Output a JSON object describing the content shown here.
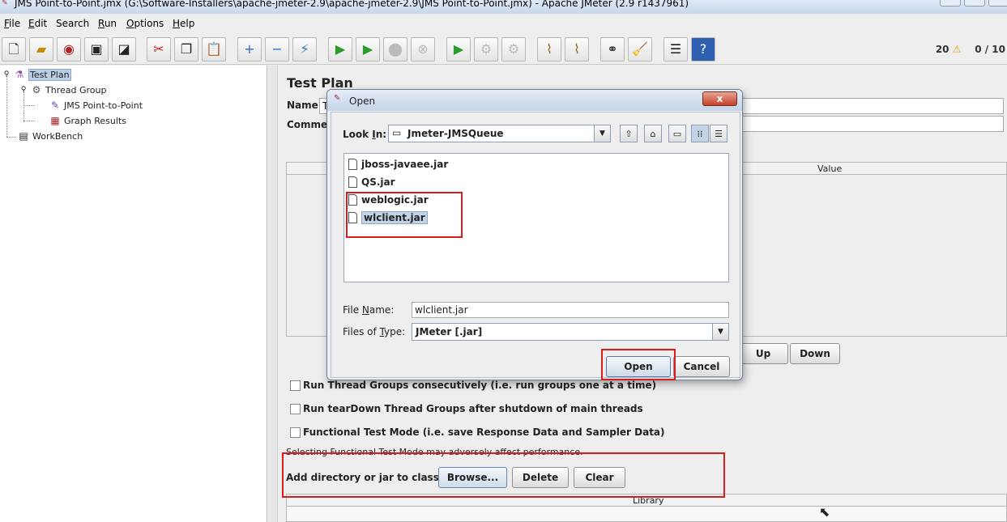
{
  "window": {
    "title": "JMS Point-to-Point.jmx (G:\\Software-Installers\\apache-jmeter-2.9\\apache-jmeter-2.9\\JMS Point-to-Point.jmx) - Apache JMeter (2.9 r1437961)"
  },
  "menu": [
    {
      "label": "File",
      "mnemonic": "F",
      "rest": "ile"
    },
    {
      "label": "Edit",
      "mnemonic": "E",
      "rest": "dit"
    },
    {
      "label": "Search",
      "mnemonic": "",
      "rest": "Search"
    },
    {
      "label": "Run",
      "mnemonic": "R",
      "rest": "un"
    },
    {
      "label": "Options",
      "mnemonic": "O",
      "rest": "ptions"
    },
    {
      "label": "Help",
      "mnemonic": "H",
      "rest": "elp"
    }
  ],
  "toolbar": {
    "icons": [
      "new-icon",
      "open-icon",
      "open-recent-icon",
      "save-icon",
      "save-as-icon",
      "cut-icon",
      "copy-icon",
      "paste-icon",
      "expand-icon",
      "collapse-icon",
      "toggle-icon",
      "start-icon",
      "start-no-pause-icon",
      "stop-icon",
      "shutdown-icon",
      "remote-start-icon",
      "remote-stop-icon",
      "remote-shutdown-icon",
      "clear-icon",
      "clear-all-icon",
      "search-icon",
      "reset-search-icon",
      "function-helper-icon",
      "help-icon"
    ],
    "warning_count": "20",
    "threads": "0 / 10"
  },
  "tree": {
    "items": [
      {
        "label": "Test Plan",
        "icon": "test-plan-icon"
      },
      {
        "label": "Thread Group",
        "icon": "thread-group-icon"
      },
      {
        "label": "JMS Point-to-Point",
        "icon": "sampler-icon"
      },
      {
        "label": "Graph Results",
        "icon": "graph-icon"
      },
      {
        "label": "WorkBench",
        "icon": "workbench-icon"
      }
    ]
  },
  "test_plan": {
    "heading": "Test Plan",
    "name_label": "Name:",
    "name_value": "T",
    "comments_label": "Comments",
    "table_value_header": "Value",
    "up_label": "Up",
    "down_label": "Down",
    "options": [
      "Run Thread Groups consecutively (i.e. run groups one at a time)",
      "Run tearDown Thread Groups after shutdown of main threads",
      "Functional Test Mode (i.e. save Response Data and Sampler Data)"
    ],
    "functional_warning": "Selecting Functional Test Mode may adversely affect performance.",
    "classpath_label": "Add directory or jar to classpath",
    "browse_label": "Browse...",
    "delete_label": "Delete",
    "clear_label": "Clear",
    "library_header": "Library"
  },
  "dialog": {
    "title": "Open",
    "look_in_label": "Look In:",
    "look_in_mnemonic": "I",
    "look_in_value": "Jmeter-JMSQueue",
    "files": [
      "jboss-javaee.jar",
      "QS.jar",
      "weblogic.jar",
      "wlclient.jar"
    ],
    "selected_file": "wlclient.jar",
    "file_name_label": "File Name:",
    "file_name_value": "wlclient.jar",
    "file_type_label": "Files of Type:",
    "file_type_value": "JMeter [.jar]",
    "open_label": "Open",
    "cancel_label": "Cancel",
    "close_glyph": "x"
  }
}
